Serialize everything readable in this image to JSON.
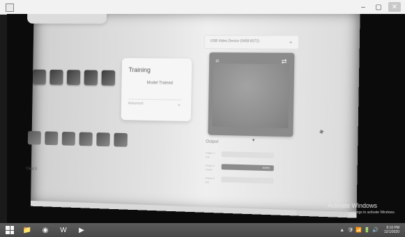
{
  "window": {
    "title": "",
    "controls": {
      "minimize": "–",
      "maximize": "▢",
      "close": "✕"
    }
  },
  "camera": {
    "device_dropdown": {
      "label": "USB Video Device (0458:6072)"
    },
    "training": {
      "title": "Training",
      "status": "Model Trained",
      "advanced_label": "Advanced"
    },
    "output": {
      "title": "Output",
      "rows": [
        {
          "name": "Class 1",
          "pct": "0%",
          "fill": 0.0,
          "fill_label": ""
        },
        {
          "name": "Class 2",
          "pct": "100%",
          "fill": 1.0,
          "fill_label": "100%"
        },
        {
          "name": "Class 3",
          "pct": "0%",
          "fill": 0.0,
          "fill_label": ""
        }
      ]
    },
    "left_edge_text": "Class 3"
  },
  "watermark": {
    "title": "Activate Windows",
    "subtitle": "Go to PC settings to activate Windows."
  },
  "taskbar": {
    "items": [
      {
        "name": "start-button",
        "glyph": ""
      },
      {
        "name": "file-explorer-button",
        "glyph": "📁"
      },
      {
        "name": "chrome-button",
        "glyph": "◉"
      },
      {
        "name": "word-button",
        "glyph": "W"
      },
      {
        "name": "media-player-button",
        "glyph": "▶"
      }
    ],
    "tray": {
      "icons": [
        "▲",
        "🛡",
        "📶",
        "🔋",
        "🔊"
      ],
      "time": "8:10 PM",
      "date": "12/1/2020"
    }
  }
}
